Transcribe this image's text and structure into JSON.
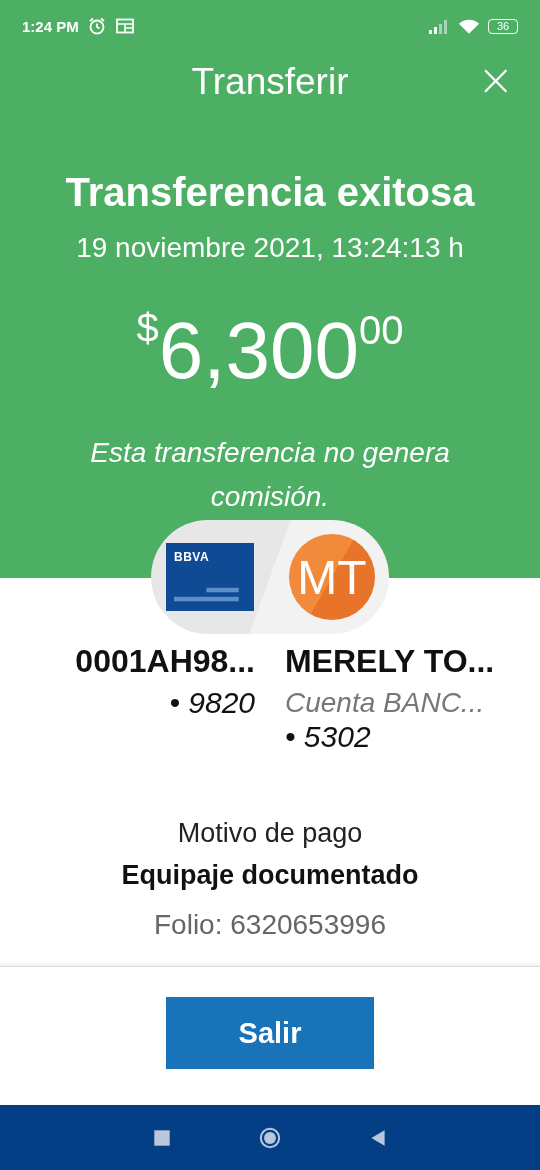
{
  "status_bar": {
    "time": "1:24 PM",
    "battery": "36"
  },
  "header": {
    "title": "Transferir",
    "close": "×"
  },
  "result": {
    "title": "Transferencia exitosa",
    "date": "19 noviembre 2021, 13:24:13 h",
    "amount": {
      "currency": "$",
      "whole": "6,300",
      "cents": "00"
    },
    "note": "Esta transferencia no genera comisión."
  },
  "origin": {
    "bank_logo": "BBVA",
    "name": "0001AH98...",
    "number": "• 9820"
  },
  "destination": {
    "initials": "MT",
    "name": "MERELY TO...",
    "account": "Cuenta BANC...",
    "number": "• 5302"
  },
  "details": [
    {
      "kind": "label",
      "text": "Motivo de pago"
    },
    {
      "kind": "value",
      "text": "Equipaje documentado"
    },
    {
      "kind": "folio",
      "text": "Folio: 6320653996"
    }
  ],
  "button": {
    "label": "Salir"
  }
}
